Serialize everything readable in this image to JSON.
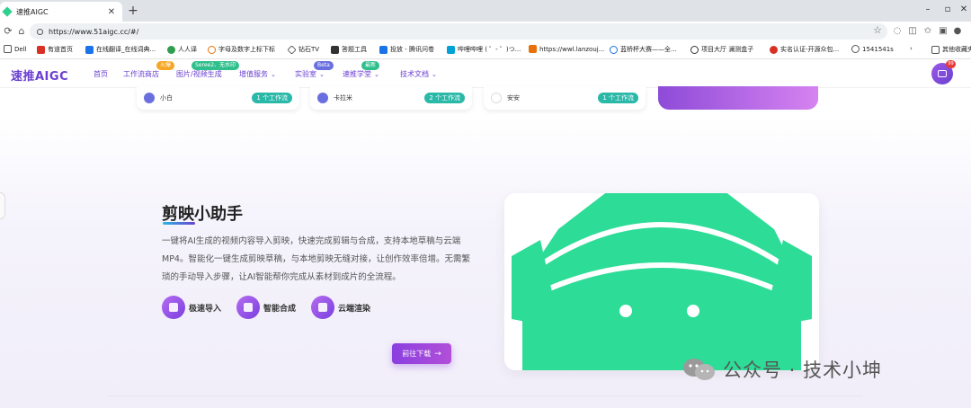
{
  "browser": {
    "tab_title": "速推AIGC",
    "tab_close": "✕",
    "new_tab": "+",
    "url": "https://www.51aigc.cc/#/",
    "window_min": "–",
    "window_max": "▫",
    "window_close": "✕"
  },
  "bookmarks": [
    {
      "label": "Dell",
      "color": "#555555"
    },
    {
      "label": "有道首页",
      "color": "#d93025"
    },
    {
      "label": "在线翻译_在线词典...",
      "color": "#1a73e8"
    },
    {
      "label": "人人译",
      "color": "#2e9e4f"
    },
    {
      "label": "字母及数字上标下标",
      "color": "#e8710a"
    },
    {
      "label": "钻石TV",
      "color": "#444444"
    },
    {
      "label": "答题工具",
      "color": "#333333"
    },
    {
      "label": "投放 - 腾讯问卷",
      "color": "#1a73e8"
    },
    {
      "label": "哔哩哔哩 ( ゜- ゜)つ...",
      "color": "#00a1d6"
    },
    {
      "label": "https://wwl.lanzouj...",
      "color": "#e8710a"
    },
    {
      "label": "蓝桥杯大赛——全...",
      "color": "#1a73e8"
    },
    {
      "label": "项目大厅 澜测盒子",
      "color": "#333333"
    },
    {
      "label": "实名认证-开源众包...",
      "color": "#d93025"
    },
    {
      "label": "1541541s",
      "color": "#555555"
    },
    {
      "label": "其他收藏夹",
      "color": "#555555"
    }
  ],
  "site": {
    "logo": "速推AIGC",
    "nav": [
      {
        "label": "首页",
        "has_chevron": false
      },
      {
        "label": "工作流商店",
        "has_chevron": false,
        "badge": "火爆",
        "badge_color": "#f5a623"
      },
      {
        "label": "图片/视频生成",
        "has_chevron": false,
        "badge": "Seree2、无水印",
        "badge_color": "#2fbf8c"
      },
      {
        "label": "增值服务",
        "has_chevron": true
      },
      {
        "label": "实验室",
        "has_chevron": true,
        "badge": "Beta",
        "badge_color": "#6a6fe0"
      },
      {
        "label": "速推学堂",
        "has_chevron": true,
        "badge": "最新",
        "badge_color": "#2fbf8c"
      },
      {
        "label": "技术文档",
        "has_chevron": true
      }
    ],
    "avatar_badge": "99"
  },
  "top_cards": [
    {
      "name": "小白",
      "tag": "1 个工作流",
      "avatar_color": "#6a6fe0"
    },
    {
      "name": "卡拉米",
      "tag": "2 个工作流",
      "avatar_color": "#6a6fe0"
    },
    {
      "name": "安安",
      "tag": "1 个工作流",
      "avatar_color": "#e6e6e6"
    }
  ],
  "feature": {
    "title": "剪映小助手",
    "description": "一键将AI生成的视频内容导入剪映，快速完成剪辑与合成，支持本地草稿与云端MP4。智能化一键生成剪映草稿，与本地剪映无缝对接，让创作效率倍增。无需繁琐的手动导入步骤，让AI智能帮你完成从素材到成片的全流程。",
    "items": [
      {
        "label": "极速导入",
        "icon": "rocket-icon"
      },
      {
        "label": "智能合成",
        "icon": "brush-icon"
      },
      {
        "label": "云端渲染",
        "icon": "cloud-icon"
      }
    ],
    "download": "前往下载",
    "download_arrow": "→",
    "accent": "#2ddc96"
  },
  "watermark": "公众号 · 技术小坤"
}
